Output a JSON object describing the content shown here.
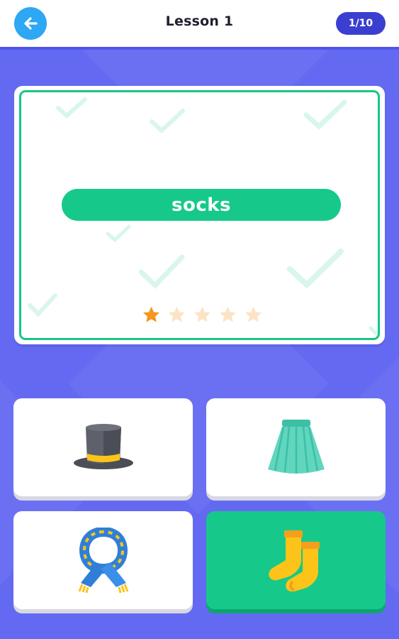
{
  "header": {
    "title": "Lesson 1",
    "progress": "1/10"
  },
  "quiz": {
    "word": "socks",
    "rating": 1,
    "rating_max": 5
  },
  "options": [
    {
      "item": "top-hat",
      "selected": false
    },
    {
      "item": "skirt",
      "selected": false
    },
    {
      "item": "scarf",
      "selected": false
    },
    {
      "item": "socks",
      "selected": true
    }
  ],
  "colors": {
    "background": "#6469f2",
    "accent_green": "#16c98a",
    "back_button": "#2ea7f5",
    "progress_pill": "#3b3fcf",
    "star_active": "#f5961d",
    "star_inactive": "#fde3c6"
  }
}
